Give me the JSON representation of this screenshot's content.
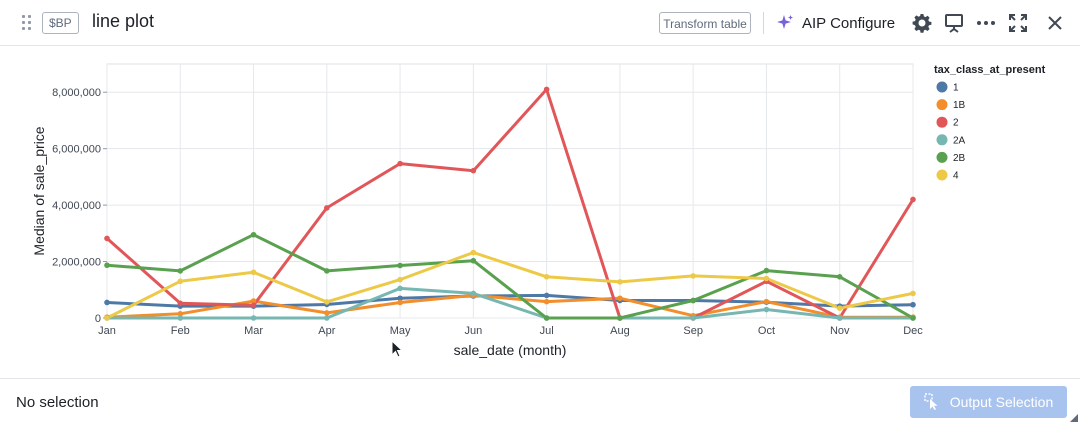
{
  "header": {
    "tag": "$BP",
    "title": "line plot",
    "transform_label": "Transform table",
    "aip_label": "AIP Configure",
    "icons": [
      "drag-handle-icon",
      "gear-icon",
      "presentation-icon",
      "more-icon",
      "maximize-icon",
      "close-icon"
    ]
  },
  "footer": {
    "selection_text": "No selection",
    "output_label": "Output Selection"
  },
  "colors": {
    "1": "#4e79a7",
    "1B": "#f28e2b",
    "2": "#e15759",
    "2A": "#76b7b2",
    "2B": "#59a14f",
    "4": "#edc948"
  },
  "chart_data": {
    "type": "line",
    "xlabel": "sale_date (month)",
    "ylabel": "Median of sale_price",
    "legend_title": "tax_class_at_present",
    "legend_position": "right",
    "grid": true,
    "ylim": [
      0,
      9000000
    ],
    "yticks": [
      0,
      2000000,
      4000000,
      6000000,
      8000000
    ],
    "ytick_labels": [
      "0",
      "2,000,000",
      "4,000,000",
      "6,000,000",
      "8,000,000"
    ],
    "categories": [
      "Jan",
      "Feb",
      "Mar",
      "Apr",
      "May",
      "Jun",
      "Jul",
      "Aug",
      "Sep",
      "Oct",
      "Nov",
      "Dec"
    ],
    "series": [
      {
        "name": "1",
        "values": [
          550000,
          420000,
          420000,
          480000,
          700000,
          780000,
          800000,
          620000,
          620000,
          560000,
          420000,
          470000
        ]
      },
      {
        "name": "1B",
        "values": [
          30000,
          150000,
          600000,
          180000,
          550000,
          800000,
          580000,
          700000,
          80000,
          580000,
          30000,
          30000
        ]
      },
      {
        "name": "2",
        "values": [
          2820000,
          520000,
          450000,
          3900000,
          5470000,
          5220000,
          8100000,
          0,
          0,
          1300000,
          0,
          4200000
        ]
      },
      {
        "name": "2A",
        "values": [
          0,
          0,
          0,
          0,
          1050000,
          870000,
          0,
          0,
          0,
          300000,
          0,
          0
        ]
      },
      {
        "name": "2B",
        "values": [
          1870000,
          1670000,
          2950000,
          1670000,
          1860000,
          2030000,
          0,
          0,
          620000,
          1680000,
          1460000,
          0
        ]
      },
      {
        "name": "4",
        "values": [
          0,
          1300000,
          1620000,
          570000,
          1360000,
          2320000,
          1460000,
          1280000,
          1490000,
          1400000,
          350000,
          870000
        ]
      }
    ]
  }
}
